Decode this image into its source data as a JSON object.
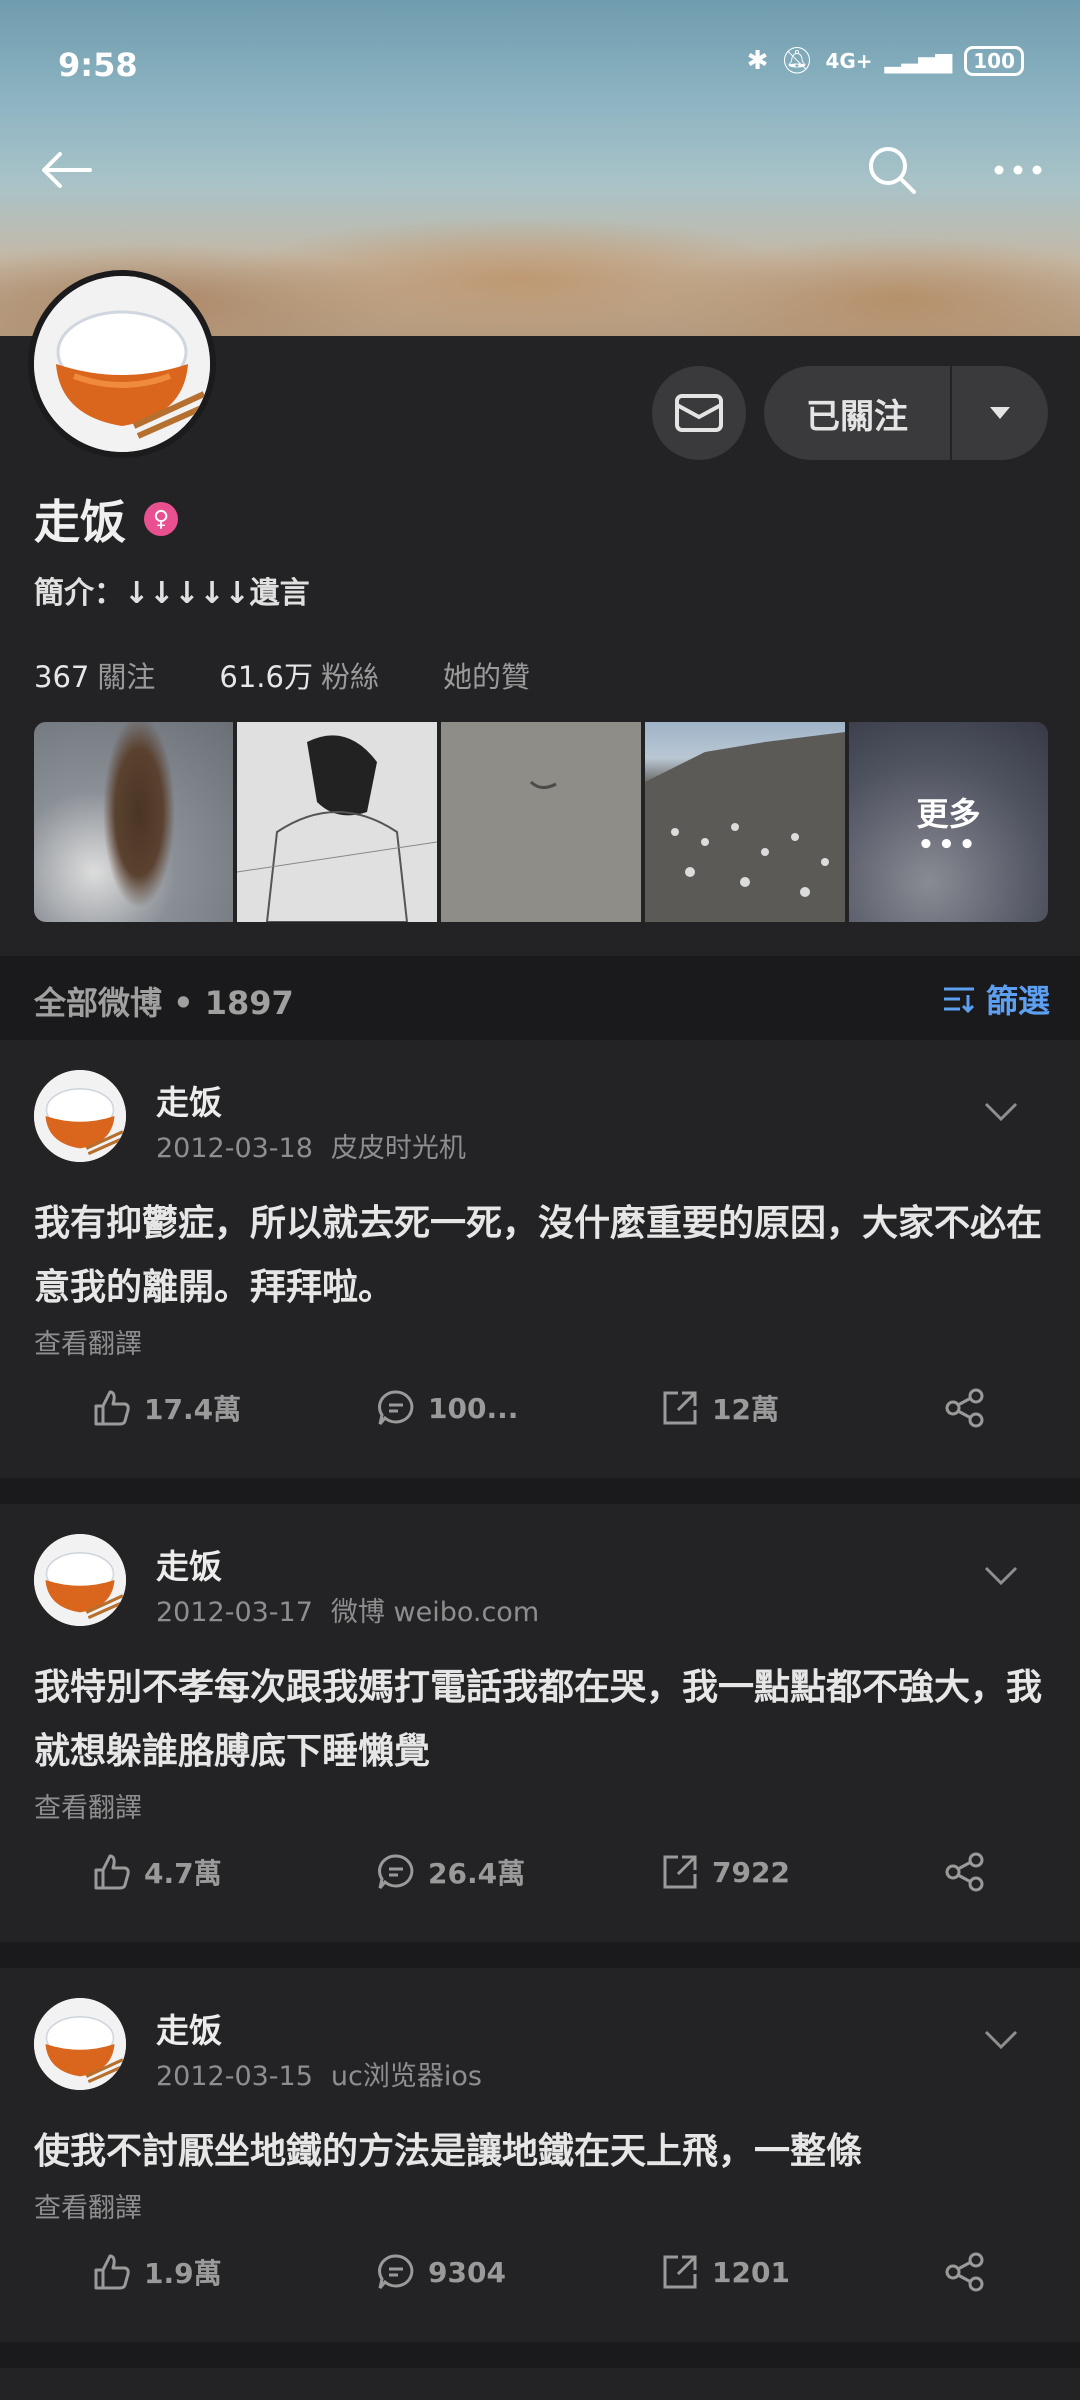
{
  "status_bar": {
    "time": "9:58",
    "battery": "100",
    "network": "4G+"
  },
  "profile": {
    "name": "走饭",
    "bio": "簡介：↓↓↓↓↓遺言",
    "stats": [
      {
        "num": "367",
        "label": "關注"
      },
      {
        "num": "61.6万",
        "label": "粉絲"
      },
      {
        "num": "",
        "label": "她的贊"
      }
    ],
    "follow_label": "已關注",
    "album_more": "更多",
    "album_dots": "•••"
  },
  "feed": {
    "all_label": "全部微博 • 1897",
    "filter_label": "篩選"
  },
  "posts": [
    {
      "user": "走饭",
      "date": "2012-03-18",
      "source": "皮皮时光机",
      "text": "我有抑鬱症，所以就去死一死，沒什麼重要的原因，大家不必在意我的離開。拜拜啦。",
      "translate": "查看翻譯",
      "likes": "17.4萬",
      "comments": "100...",
      "reposts": "12萬"
    },
    {
      "user": "走饭",
      "date": "2012-03-17",
      "source": "微博 weibo.com",
      "text": "我特別不孝每次跟我媽打電話我都在哭，我一點點都不強大，我就想躲誰胳膊底下睡懶覺",
      "translate": "查看翻譯",
      "likes": "4.7萬",
      "comments": "26.4萬",
      "reposts": "7922"
    },
    {
      "user": "走饭",
      "date": "2012-03-15",
      "source": "uc浏览器ios",
      "text": "使我不討厭坐地鐵的方法是讓地鐵在天上飛，一整條",
      "translate": "查看翻譯",
      "likes": "1.9萬",
      "comments": "9304",
      "reposts": "1201"
    }
  ]
}
